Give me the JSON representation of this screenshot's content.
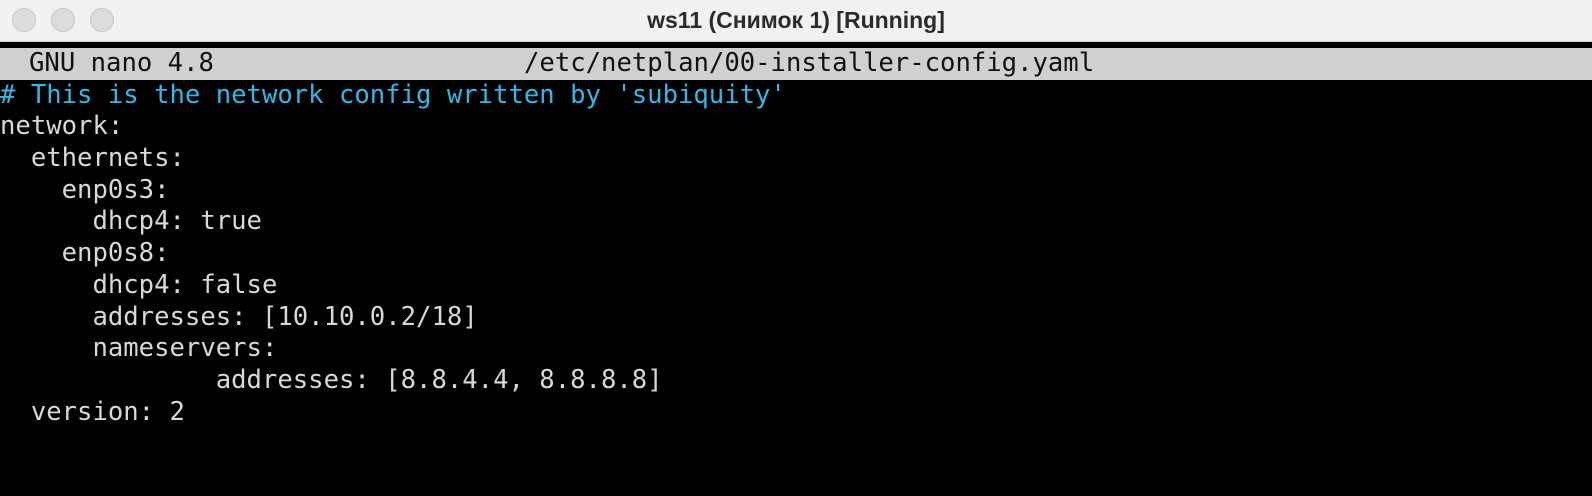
{
  "window": {
    "title": "ws11 (Снимок 1) [Running]"
  },
  "nano": {
    "version": "GNU nano 4.8",
    "filename": "/etc/netplan/00-installer-config.yaml"
  },
  "editor": {
    "comment_color": "#2fb8ea",
    "text_color": "#d8d8d8",
    "lines": [
      "# This is the network config written by 'subiquity'",
      "network:",
      "  ethernets:",
      "    enp0s3:",
      "      dhcp4: true",
      "    enp0s8:",
      "      dhcp4: false",
      "      addresses: [10.10.0.2/18]",
      "      nameservers:",
      "              addresses: [8.8.4.4, 8.8.8.8]",
      "  version: 2"
    ]
  }
}
